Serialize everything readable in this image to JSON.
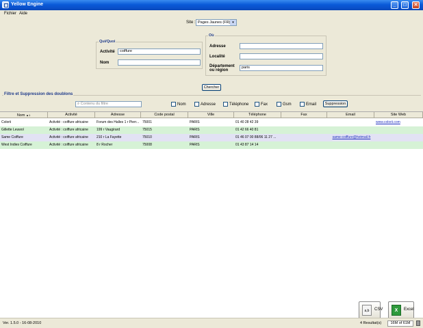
{
  "window": {
    "title": "Yellow Engine"
  },
  "window_controls": [
    "_",
    "□",
    "✕"
  ],
  "menu": {
    "items": [
      "Fichier",
      "Aide"
    ]
  },
  "site": {
    "label": "Site :",
    "value": "Pages Jaunes (FR)",
    "arrow": "▾"
  },
  "quiquoi": {
    "title": "Qui/Quoi",
    "activite_label": "Activité",
    "activite_value": "coiffure",
    "nom_label": "Nom",
    "nom_value": ""
  },
  "ou": {
    "title": "Où",
    "adresse_label": "Adresse",
    "adresse_value": "",
    "localite_label": "Localité",
    "localite_value": "",
    "dept_label_1": "Département",
    "dept_label_2": "ou région",
    "dept_value": "paris"
  },
  "search_button": "Chercher",
  "filters": {
    "title": "Filtre et Suppression des doublons",
    "input_placeholder": "Contenu du filtre",
    "checks": [
      "Nom",
      "Adresse",
      "Téléphone",
      "Fax",
      "Gsm",
      "Email"
    ],
    "delete_button": "Suppression"
  },
  "table": {
    "columns": [
      "Nom",
      "Activité",
      "Adresse",
      "Code postal",
      "Ville",
      "Téléphone",
      "Fax",
      "Email",
      "Site Web"
    ],
    "sort_indicator": "▲1",
    "rows": [
      [
        "Colorii",
        "Activité : coiffure africaine",
        "Forum des Halles 1 r Pierr...",
        "75001",
        "PARIS",
        "01 40 28 42 39",
        "",
        "",
        "www.colorii.com"
      ],
      [
        "Gillette Leuwol",
        "Activité : coiffure africaine",
        "199 r Vaugirard",
        "75015",
        "PARIS",
        "01 42 66 40 81",
        "",
        "",
        ""
      ],
      [
        "Same Coiffure",
        "Activité : coiffure africaine",
        "210 r La Fayette",
        "75010",
        "PARIS",
        "01 46 07 00 88/06 11 27 ...",
        "",
        "same-coiffure@hotmail.fr",
        ""
      ],
      [
        "West Indies Coiffure",
        "Activité : coiffure africaine",
        "8 r Rocher",
        "75008",
        "PARIS",
        "01 43 87 14 14",
        "",
        "",
        ""
      ]
    ],
    "row_colors": [
      "#ffffff",
      "#d6f2d6",
      "#e2e2f4",
      "#d6f2d6"
    ]
  },
  "export": {
    "csv_label": "CSV",
    "excel_label": "Excel",
    "csv_icon": "csv-file-icon",
    "excel_icon": "excel-file-icon",
    "excel_glyph": "X",
    "csv_glyph": "a,b"
  },
  "status": {
    "version": "Ver. 1.5.0 - 16-08-2010",
    "results": "4 Resultat(s)",
    "memory": "16M of 61M"
  }
}
